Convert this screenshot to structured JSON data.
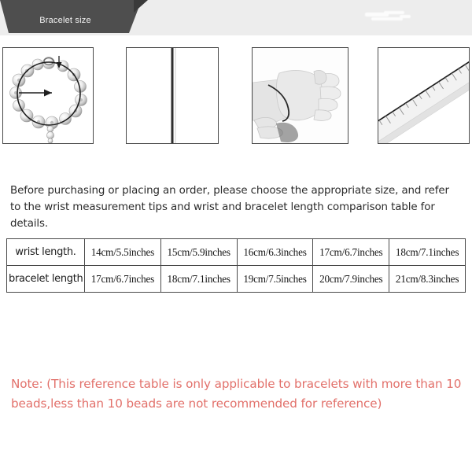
{
  "header": {
    "banner_label": "Bracelet size",
    "banner_color": "#4e4e4e",
    "strip_color": "#ededed",
    "notch_color": "#3a3a3a"
  },
  "panels": [
    {
      "name": "bracelet-diameter-photo",
      "caption": "",
      "description": "beaded charm bracelet shown as a circle with a diameter arrow"
    },
    {
      "name": "string-straight-photo",
      "caption": "",
      "description": "a straight vertical string laid flat"
    },
    {
      "name": "wrist-measure-photo",
      "caption": "",
      "description": "hand and wrist with a string wrapped around the wrist"
    },
    {
      "name": "ruler-photo",
      "caption": "",
      "description": "a transparent ruler placed diagonally"
    }
  ],
  "intro": {
    "text": "Before purchasing or placing an order, please choose the appropriate size, and refer to the wrist measurement tips and wrist and bracelet length comparison table for details."
  },
  "table": {
    "rows": [
      {
        "label": "wrist length.",
        "values": [
          "14cm/5.5inches",
          "15cm/5.9inches",
          "16cm/6.3inches",
          "17cm/6.7inches",
          "18cm/7.1inches"
        ]
      },
      {
        "label": "bracelet length",
        "values": [
          "17cm/6.7inches",
          "18cm/7.1inches",
          "19cm/7.5inches",
          "20cm/7.9inches",
          "21cm/8.3inches"
        ]
      }
    ]
  },
  "note": {
    "text": "Note: (This reference table is only applicable to bracelets with more than 10 beads,less than 10 beads are not recommended for reference)",
    "color": "#e2706a"
  }
}
